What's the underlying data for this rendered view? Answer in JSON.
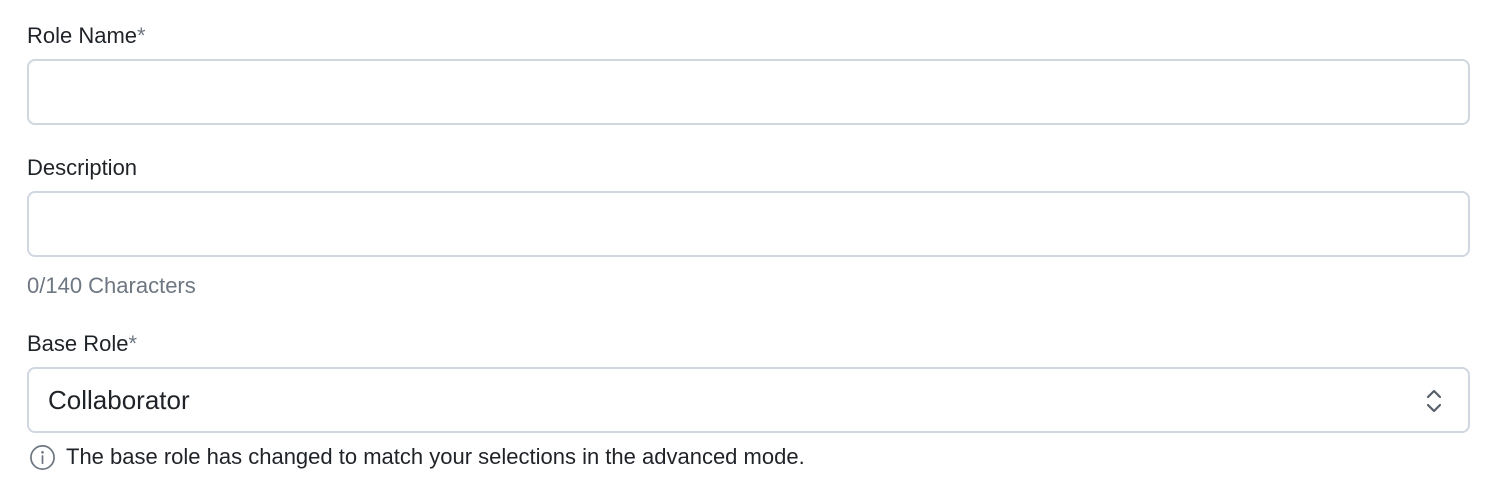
{
  "form": {
    "role_name": {
      "label": "Role Name",
      "required_mark": "*",
      "value": "",
      "placeholder": ""
    },
    "description": {
      "label": "Description",
      "value": "",
      "placeholder": "",
      "counter": "0/140 Characters"
    },
    "base_role": {
      "label": "Base Role",
      "required_mark": "*",
      "selected": "Collaborator",
      "hint_icon": "info-icon",
      "hint": "The base role has changed to match your selections in the advanced mode."
    }
  }
}
